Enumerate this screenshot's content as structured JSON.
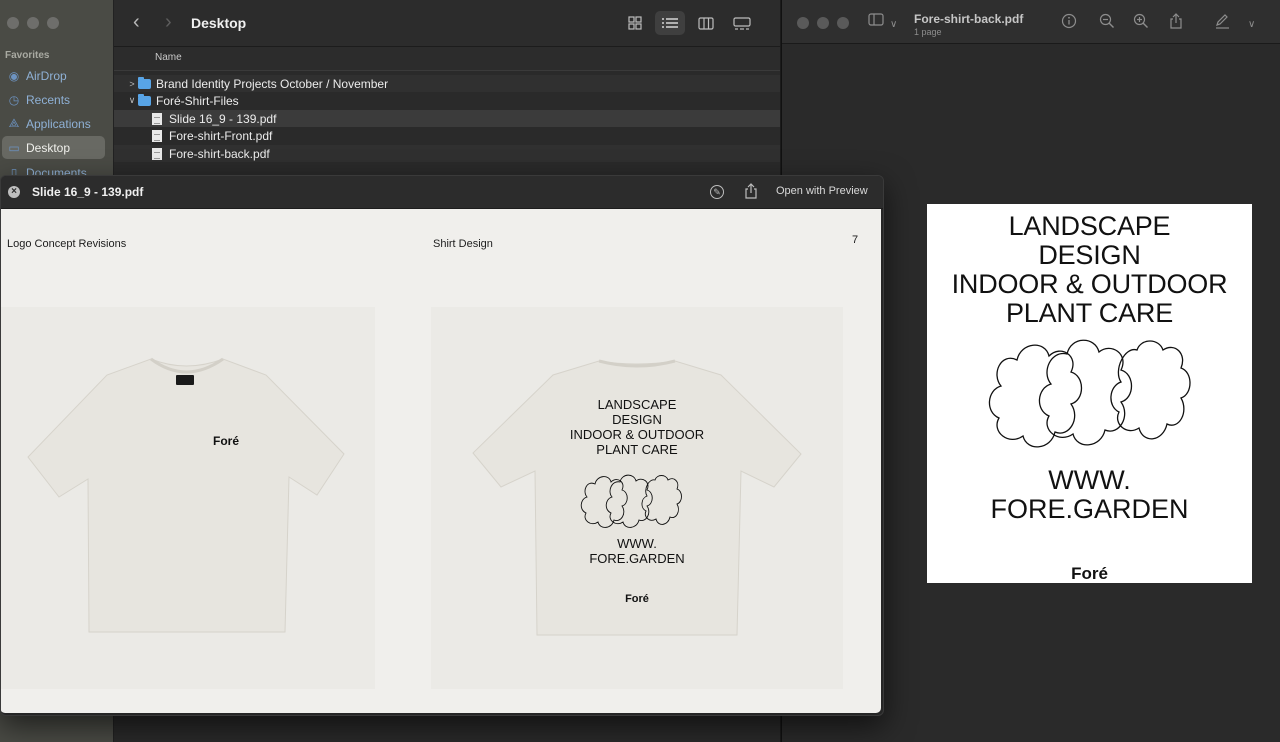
{
  "finder": {
    "title": "Desktop",
    "sidebar": {
      "section": "Favorites",
      "items": [
        {
          "label": "AirDrop",
          "icon": "airdrop-icon"
        },
        {
          "label": "Recents",
          "icon": "clock-icon"
        },
        {
          "label": "Applications",
          "icon": "applications-icon"
        },
        {
          "label": "Desktop",
          "icon": "desktop-icon",
          "selected": true
        },
        {
          "label": "Documents",
          "icon": "document-icon"
        }
      ]
    },
    "column_header": "Name",
    "files": [
      {
        "name": "Brand Identity Projects October / November",
        "type": "folder",
        "expanded": false
      },
      {
        "name": "Foré-Shirt-Files",
        "type": "folder",
        "expanded": true
      },
      {
        "name": "Slide 16_9 - 139.pdf",
        "type": "pdf",
        "selected": true
      },
      {
        "name": "Fore-shirt-Front.pdf",
        "type": "pdf"
      },
      {
        "name": "Fore-shirt-back.pdf",
        "type": "pdf"
      }
    ],
    "view_modes": [
      "icon-view",
      "list-view",
      "column-view",
      "gallery-view"
    ],
    "active_view": "list-view"
  },
  "preview": {
    "title": "Fore-shirt-back.pdf",
    "subtitle": "1 page",
    "page": {
      "headline": [
        "LANDSCAPE",
        "DESIGN",
        "INDOOR & OUTDOOR",
        "PLANT CARE"
      ],
      "website": [
        "WWW.",
        "FORE.GARDEN"
      ],
      "brand": "Foré"
    }
  },
  "quicklook": {
    "title": "Slide 16_9 - 139.pdf",
    "open_label": "Open with Preview",
    "slide": {
      "left_label": "Logo Concept Revisions",
      "right_label": "Shirt Design",
      "page_number": "7",
      "front_brand": "Foré",
      "back_headline": [
        "LANDSCAPE",
        "DESIGN",
        "INDOOR & OUTDOOR",
        "PLANT CARE"
      ],
      "back_website": [
        "WWW.",
        "FORE.GARDEN"
      ],
      "back_brand": "Foré"
    }
  },
  "colors": {
    "folder": "#58a4e6",
    "sidebar_link": "#8fb1d6",
    "shirt": "#e7e5df",
    "slide_bg": "#f0efec"
  }
}
